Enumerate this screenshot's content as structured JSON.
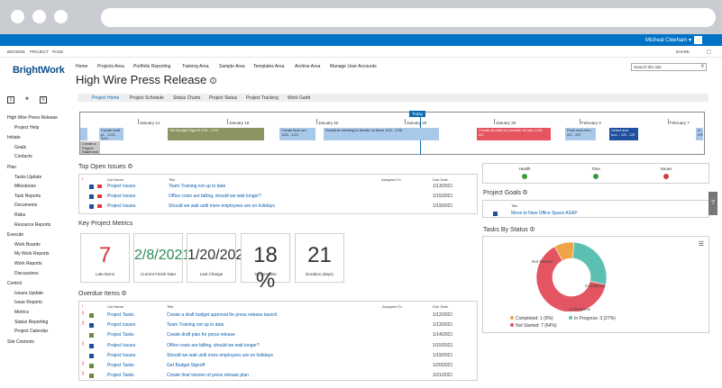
{
  "suite_bar": {
    "user": "Micheal Cleeham ▾"
  },
  "ribbon": {
    "tabs": [
      "BROWSE",
      "PROJECT",
      "PAGE"
    ],
    "share": "SHARE"
  },
  "logo": "BrightWork",
  "top_nav": [
    "Home",
    "Projects Area",
    "Portfolio Reporting",
    "Training Area",
    "Sample Area",
    "Templates Area",
    "Archive Area",
    "Manage User Accounts"
  ],
  "page_title": "High Wire Press Release",
  "search": {
    "placeholder": "Search this site"
  },
  "left_nav": [
    {
      "label": "High Wire Press Release",
      "level": 0
    },
    {
      "label": "Project Help",
      "level": 1
    },
    {
      "label": "Initiate",
      "level": 0
    },
    {
      "label": "Goals",
      "level": 1
    },
    {
      "label": "Contacts",
      "level": 1
    },
    {
      "label": "Plan",
      "level": 0
    },
    {
      "label": "Tasks Update",
      "level": 1
    },
    {
      "label": "Milestones",
      "level": 1
    },
    {
      "label": "Task Reports",
      "level": 1
    },
    {
      "label": "Documents",
      "level": 1
    },
    {
      "label": "Risks",
      "level": 1
    },
    {
      "label": "Resource Reports",
      "level": 1
    },
    {
      "label": "Execute",
      "level": 0
    },
    {
      "label": "Work Boards",
      "level": 1
    },
    {
      "label": "My Work Reports",
      "level": 1
    },
    {
      "label": "Work Reports",
      "level": 1
    },
    {
      "label": "Discussions",
      "level": 1
    },
    {
      "label": "Control",
      "level": 0
    },
    {
      "label": "Issues Update",
      "level": 1
    },
    {
      "label": "Issue Reports",
      "level": 1
    },
    {
      "label": "Metrics",
      "level": 1
    },
    {
      "label": "Status Reporting",
      "level": 1
    },
    {
      "label": "Project Calendar",
      "level": 1
    },
    {
      "label": "Site Contents",
      "level": 0
    }
  ],
  "tabs": [
    "Project Home",
    "Project Schedule",
    "Status Charts",
    "Project Status",
    "Project Tracking",
    "Work Gantt"
  ],
  "timeline": {
    "today_label": "Today",
    "dates": [
      "January 14",
      "January 18",
      "January 22",
      "January 26",
      "January 30",
      "February 3",
      "February 7"
    ],
    "bars": [
      {
        "text": "Create a Project Statement",
        "color": "grey"
      },
      {
        "text": "Create draft pl... 1/13 - 1/14",
        "color": "blue"
      },
      {
        "text": "Get Budget Signoff 1/15 - 1/20",
        "color": "olive"
      },
      {
        "text": "Create final ver... 1/20 - 1/21",
        "color": "blue"
      },
      {
        "text": "Schedule meeting to decide on team 1/22 - 1/26",
        "color": "blue"
      },
      {
        "text": "Create shortlist of possible venues 1/28 - 2/2",
        "color": "red"
      },
      {
        "text": "Price and chec... 2/2 - 2/5",
        "color": "blue"
      },
      {
        "text": "Select and boo... 2/5 - 2/8",
        "color": "navy"
      },
      {
        "text": "S... 2/9",
        "color": "blue"
      }
    ]
  },
  "top_open_issues": {
    "title": "Top Open Issues",
    "headers": [
      "!",
      "List Name",
      "Title",
      "Assigned To",
      "Due Date"
    ],
    "rows": [
      {
        "list": "Project Issues",
        "title": "Team Training not up to date",
        "due": "1/13/2021"
      },
      {
        "list": "Project Issues",
        "title": "Office costs are falling, should we wait longer?",
        "due": "1/15/2021"
      },
      {
        "list": "Project Issues",
        "title": "Should we wait until more employees are on holidays",
        "due": "1/19/2021"
      }
    ]
  },
  "metrics": {
    "title": "Key Project Metrics",
    "cards": [
      {
        "value": "7",
        "label": "Late Items"
      },
      {
        "value": "2/8/2021",
        "label": "Current Finish Date"
      },
      {
        "value": "1/20/2021",
        "label": "Last Change"
      },
      {
        "value": "18 %",
        "label": "% Complete"
      },
      {
        "value": "21",
        "label": "Duration (days)"
      }
    ]
  },
  "overdue": {
    "title": "Overdue Items",
    "headers": [
      "!",
      "List Name",
      "Title",
      "Assigned To",
      "Due Date"
    ],
    "rows": [
      {
        "list": "Project Tasks",
        "title": "Create a draft budget approval for press release launch",
        "due": "1/12/2021"
      },
      {
        "list": "Project Issues",
        "title": "Team Training not up to date",
        "due": "1/13/2021"
      },
      {
        "list": "Project Tasks",
        "title": "Create draft plan for press release",
        "due": "1/14/2021"
      },
      {
        "list": "Project Issues",
        "title": "Office costs are falling, should we wait longer?",
        "due": "1/15/2021"
      },
      {
        "list": "Project Issues",
        "title": "Should we wait until more employees are on holidays",
        "due": "1/19/2021"
      },
      {
        "list": "Project Tasks",
        "title": "Get Budget Signoff",
        "due": "1/20/2021"
      },
      {
        "list": "Project Tasks",
        "title": "Create final version of press release plan",
        "due": "1/21/2021"
      }
    ]
  },
  "health": {
    "labels": [
      "Health",
      "Time",
      "Issues"
    ]
  },
  "goals": {
    "title": "Project Goals",
    "header": "Title",
    "rows": [
      "Move to New Office Space ASAP"
    ]
  },
  "tasks_by_status": {
    "title": "Tasks By Status",
    "legend": [
      "Completed: 1 (9%)",
      "In Progress: 3 (27%)",
      "Not Started: 7 (64%)"
    ],
    "slice_labels": [
      "Not Started",
      "Completed",
      "In Progress"
    ]
  },
  "chart_data": {
    "type": "pie",
    "title": "Tasks By Status",
    "categories": [
      "Completed",
      "In Progress",
      "Not Started"
    ],
    "values": [
      1,
      3,
      7
    ],
    "colors": [
      "#f0a445",
      "#5bc0b2",
      "#e35560"
    ],
    "legend": "bottom"
  },
  "colors": {
    "suite_bar": "#0072c6",
    "link": "#0b5dad",
    "late_red": "#d53535",
    "finish_green": "#2e8b57"
  }
}
